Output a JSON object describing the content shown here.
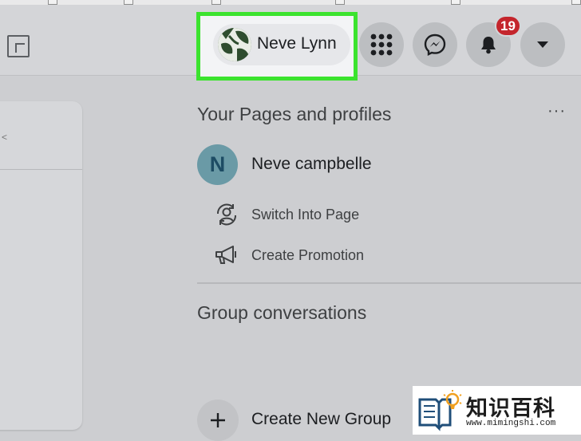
{
  "header": {
    "profile_name": "Neve Lynn",
    "notification_count": "19",
    "icons": [
      "facebook-logo-icon",
      "menu-grid-icon",
      "messenger-icon",
      "bell-icon",
      "caret-down-icon"
    ]
  },
  "pages_section": {
    "title": "Your Pages and profiles",
    "more_label": "···",
    "page": {
      "initial": "N",
      "name": "Neve campbelle"
    },
    "actions": [
      {
        "label": "Switch Into Page",
        "icon": "switch-profile-icon"
      },
      {
        "label": "Create Promotion",
        "icon": "megaphone-icon"
      }
    ]
  },
  "groups_section": {
    "title": "Group conversations",
    "create_label": "Create New Group"
  },
  "watermark": {
    "text": "知识百科",
    "url": "www.mimingshi.com"
  },
  "colors": {
    "highlight": "#3be32e",
    "badge": "#c4252c",
    "page_avatar": "#6a9aa6"
  }
}
